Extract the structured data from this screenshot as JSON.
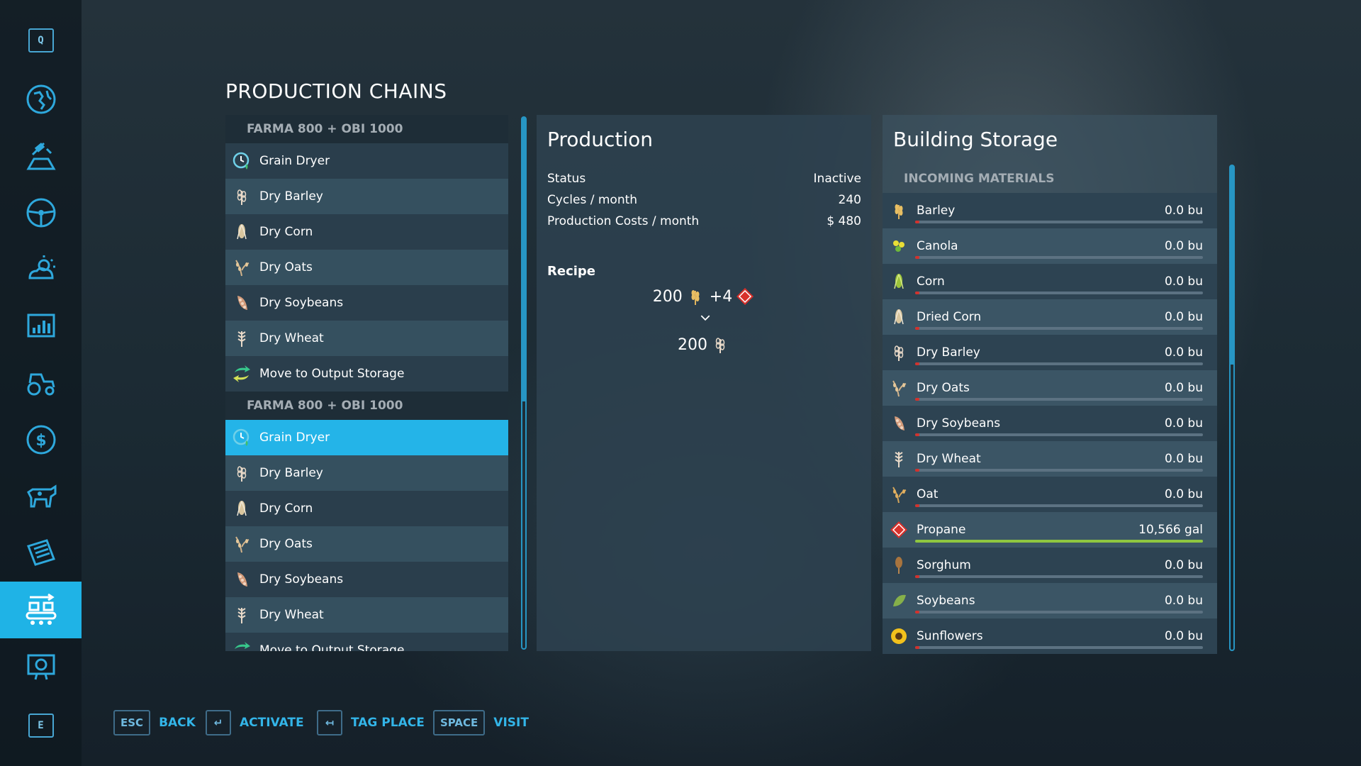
{
  "title": "PRODUCTION CHAINS",
  "sidebar": {
    "top_key": "Q",
    "bottom_key": "E",
    "items": [
      {
        "icon": "map-icon"
      },
      {
        "icon": "satellite-icon"
      },
      {
        "icon": "steering-wheel-icon"
      },
      {
        "icon": "weather-icon"
      },
      {
        "icon": "statistics-icon"
      },
      {
        "icon": "tractor-icon"
      },
      {
        "icon": "finance-icon"
      },
      {
        "icon": "animals-icon"
      },
      {
        "icon": "contracts-icon"
      },
      {
        "icon": "production-icon",
        "active": true
      },
      {
        "icon": "help-icon"
      }
    ]
  },
  "chains": [
    {
      "header": "FARMA 800 + OBI 1000",
      "items": [
        {
          "label": "Grain Dryer",
          "icon": "grain-dryer-icon"
        },
        {
          "label": "Dry Barley",
          "icon": "barley-icon"
        },
        {
          "label": "Dry Corn",
          "icon": "corn-icon"
        },
        {
          "label": "Dry Oats",
          "icon": "oats-icon"
        },
        {
          "label": "Dry Soybeans",
          "icon": "soybeans-icon"
        },
        {
          "label": "Dry Wheat",
          "icon": "wheat-icon"
        },
        {
          "label": "Move to Output Storage",
          "icon": "move-storage-icon"
        }
      ]
    },
    {
      "header": "FARMA 800 + OBI 1000",
      "items": [
        {
          "label": "Grain Dryer",
          "icon": "grain-dryer-icon",
          "selected": true
        },
        {
          "label": "Dry Barley",
          "icon": "barley-icon"
        },
        {
          "label": "Dry Corn",
          "icon": "corn-icon"
        },
        {
          "label": "Dry Oats",
          "icon": "oats-icon"
        },
        {
          "label": "Dry Soybeans",
          "icon": "soybeans-icon"
        },
        {
          "label": "Dry Wheat",
          "icon": "wheat-icon"
        },
        {
          "label": "Move to Output Storage",
          "icon": "move-storage-icon"
        }
      ]
    }
  ],
  "production": {
    "title": "Production",
    "stats": [
      {
        "label": "Status",
        "value": "Inactive"
      },
      {
        "label": "Cycles / month",
        "value": "240"
      },
      {
        "label": "Production Costs / month",
        "value": "$ 480"
      }
    ],
    "recipe_label": "Recipe",
    "recipe_input_amount": "200",
    "recipe_input_plus": "+4",
    "recipe_output_amount": "200"
  },
  "storage": {
    "title": "Building Storage",
    "subtitle": "INCOMING MATERIALS",
    "materials": [
      {
        "name": "Barley",
        "value": "0.0 bu",
        "fill": 0.0,
        "icon": "barley-icon"
      },
      {
        "name": "Canola",
        "value": "0.0 bu",
        "fill": 0.0,
        "icon": "canola-icon"
      },
      {
        "name": "Corn",
        "value": "0.0 bu",
        "fill": 0.0,
        "icon": "corn-icon"
      },
      {
        "name": "Dried Corn",
        "value": "0.0 bu",
        "fill": 0.0,
        "icon": "dried-corn-icon"
      },
      {
        "name": "Dry Barley",
        "value": "0.0 bu",
        "fill": 0.0,
        "icon": "barley-icon"
      },
      {
        "name": "Dry Oats",
        "value": "0.0 bu",
        "fill": 0.0,
        "icon": "oats-icon"
      },
      {
        "name": "Dry Soybeans",
        "value": "0.0 bu",
        "fill": 0.0,
        "icon": "soybeans-icon"
      },
      {
        "name": "Dry Wheat",
        "value": "0.0 bu",
        "fill": 0.0,
        "icon": "wheat-icon"
      },
      {
        "name": "Oat",
        "value": "0.0 bu",
        "fill": 0.0,
        "icon": "oats-icon"
      },
      {
        "name": "Propane",
        "value": "10,566 gal",
        "fill": 1.0,
        "icon": "propane-icon"
      },
      {
        "name": "Sorghum",
        "value": "0.0 bu",
        "fill": 0.0,
        "icon": "sorghum-icon"
      },
      {
        "name": "Soybeans",
        "value": "0.0 bu",
        "fill": 0.0,
        "icon": "soybeans-icon"
      },
      {
        "name": "Sunflowers",
        "value": "0.0 bu",
        "fill": 0.0,
        "icon": "sunflower-icon"
      }
    ]
  },
  "footer": [
    {
      "key": "ESC",
      "label": "BACK"
    },
    {
      "key": "↵",
      "label": "ACTIVATE"
    },
    {
      "key": "↤",
      "label": "TAG PLACE"
    },
    {
      "key": "SPACE",
      "label": "VISIT"
    }
  ],
  "colors": {
    "accent": "#24b4e8",
    "bar_full": "#8fc640",
    "bar_empty_tick": "#d2322d"
  }
}
